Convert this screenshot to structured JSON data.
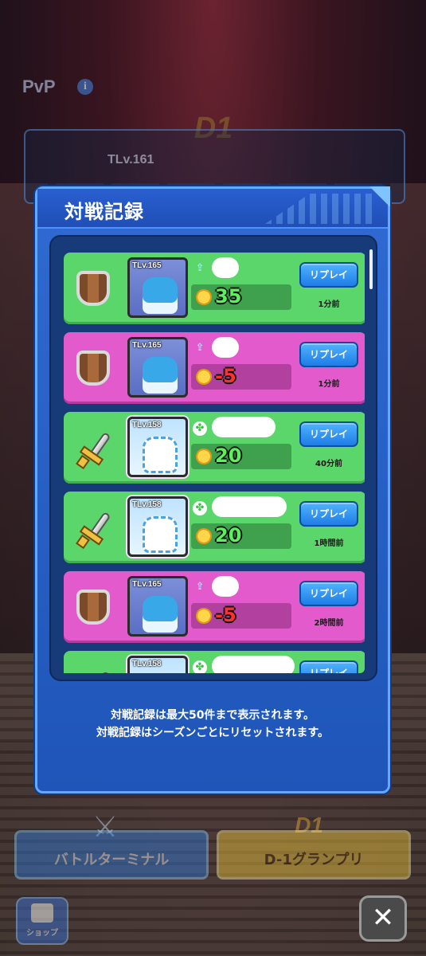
{
  "background": {
    "pvp_title": "PvP",
    "rank_emblem": "D1",
    "tlv": "TLv.161"
  },
  "dialog": {
    "title": "対戦記録",
    "notes": [
      "対戦記録は最大50件まで表示されます。",
      "対戦記録はシーズンごとにリセットされます。"
    ]
  },
  "battles": [
    {
      "result": "win",
      "type": "shield-icon",
      "tlv": "TLv.165",
      "score": "35",
      "replay_label": "リプレイ",
      "time": "1分前"
    },
    {
      "result": "lose",
      "type": "shield-icon",
      "tlv": "TLv.165",
      "score": "-5",
      "replay_label": "リプレイ",
      "time": "1分前"
    },
    {
      "result": "win",
      "type": "sword-icon",
      "tlv": "TLv.158",
      "score": "20",
      "replay_label": "リプレイ",
      "time": "40分前"
    },
    {
      "result": "win",
      "type": "sword-icon",
      "tlv": "TLv.158",
      "score": "20",
      "replay_label": "リプレイ",
      "time": "1時間前"
    },
    {
      "result": "lose",
      "type": "shield-icon",
      "tlv": "TLv.165",
      "score": "-5",
      "replay_label": "リプレイ",
      "time": "2時間前"
    },
    {
      "result": "win",
      "type": "sword-icon",
      "tlv": "TLv.158",
      "score": "",
      "replay_label": "リプレイ",
      "time": ""
    }
  ],
  "bottom": {
    "terminal_label": "バトルターミナル",
    "d1_label": "D-1グランプリ",
    "d1_badge": "D1",
    "shop_label": "ショップ",
    "close_symbol": "✕"
  },
  "colors": {
    "win_row": "#5bd66a",
    "lose_row": "#e25acb",
    "dialog_bg": "#2f6ad2",
    "replay_button": "#1f7ce6"
  }
}
